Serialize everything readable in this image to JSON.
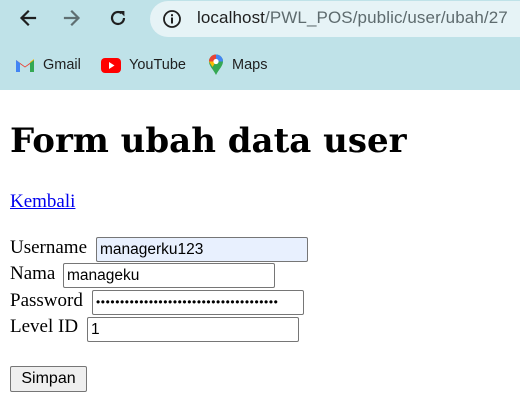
{
  "browser": {
    "url_host": "localhost",
    "url_path": "/PWL_POS/public/user/ubah/27",
    "bookmarks": [
      {
        "label": "Gmail",
        "icon": "gmail-icon"
      },
      {
        "label": "YouTube",
        "icon": "youtube-icon"
      },
      {
        "label": "Maps",
        "icon": "maps-icon"
      }
    ]
  },
  "page": {
    "title": "Form ubah data user",
    "back_link": "Kembali",
    "form": {
      "username_label": "Username",
      "username_value": "managerku123",
      "nama_label": "Nama",
      "nama_value": "manageku",
      "password_label": "Password",
      "password_value": "••••••••••••••••••••••••••••••••••••••",
      "level_label": "Level ID",
      "level_value": "1",
      "submit_label": "Simpan"
    }
  },
  "colors": {
    "chrome_background": "#bfe2e8",
    "link": "#0000ee",
    "autofill_background": "#e8f0fe"
  }
}
